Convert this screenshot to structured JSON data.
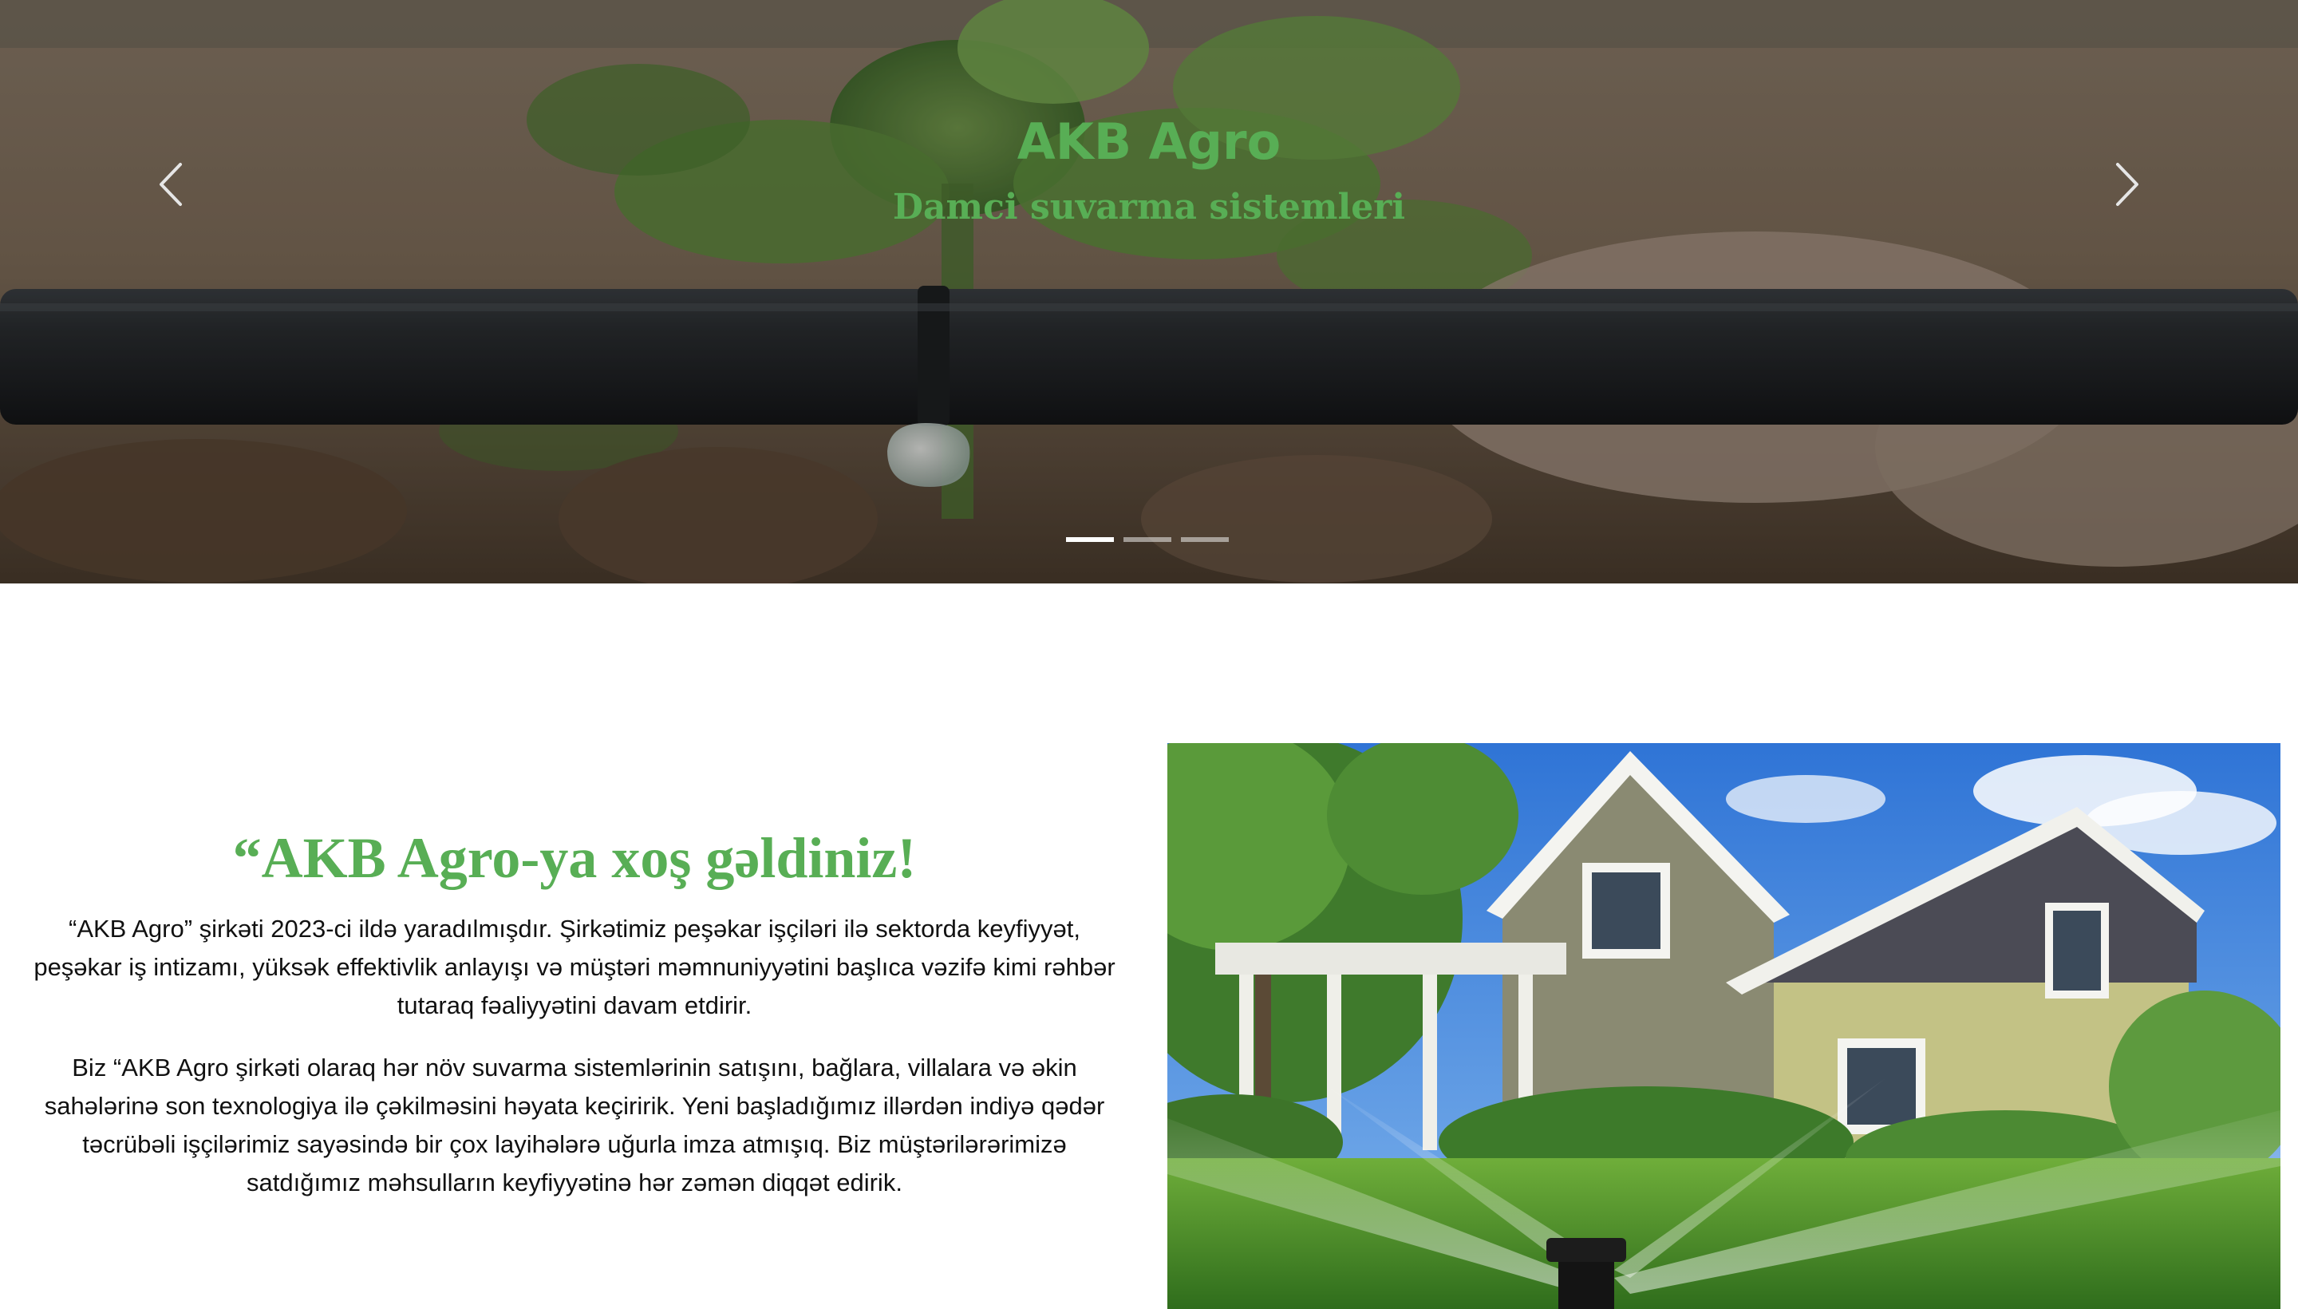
{
  "hero": {
    "title": "AKB Agro",
    "subtitle": "Damci suvarma sistemleri",
    "prev_icon": "chevron-left-icon",
    "next_icon": "chevron-right-icon",
    "slides_count": 3,
    "active_slide": 1
  },
  "welcome": {
    "heading": "“AKB Agro-ya xoş gəldiniz!",
    "paragraph_1": "“AKB Agro” şirkəti 2023-ci ildə yaradılmışdır. Şirkətimiz peşəkar işçiləri ilə sektorda keyfiyyət, peşəkar iş intizamı, yüksək effektivlik anlayışı və müştəri məmnuniyyətini başlıca vəzifə kimi rəhbər tutaraq fəaliyyətini davam etdirir.",
    "paragraph_2": "Biz “AKB Agro şirkəti olaraq hər növ suvarma sistemlərinin satışını, bağlara, villalara və əkin sahələrinə son texnologiya ilə çəkilməsini həyata keçiririk. Yeni başladığımız illərdən indiyə qədər təcrübəli işçilərimiz sayəsində bir çox layihələrə uğurla imza atmışıq. Biz müştərilərərimizə satdığımız məhsulların keyfiyyətinə hər zəmən diqqət edirik."
  },
  "colors": {
    "brand_green": "#58ae55",
    "text": "#111111"
  }
}
